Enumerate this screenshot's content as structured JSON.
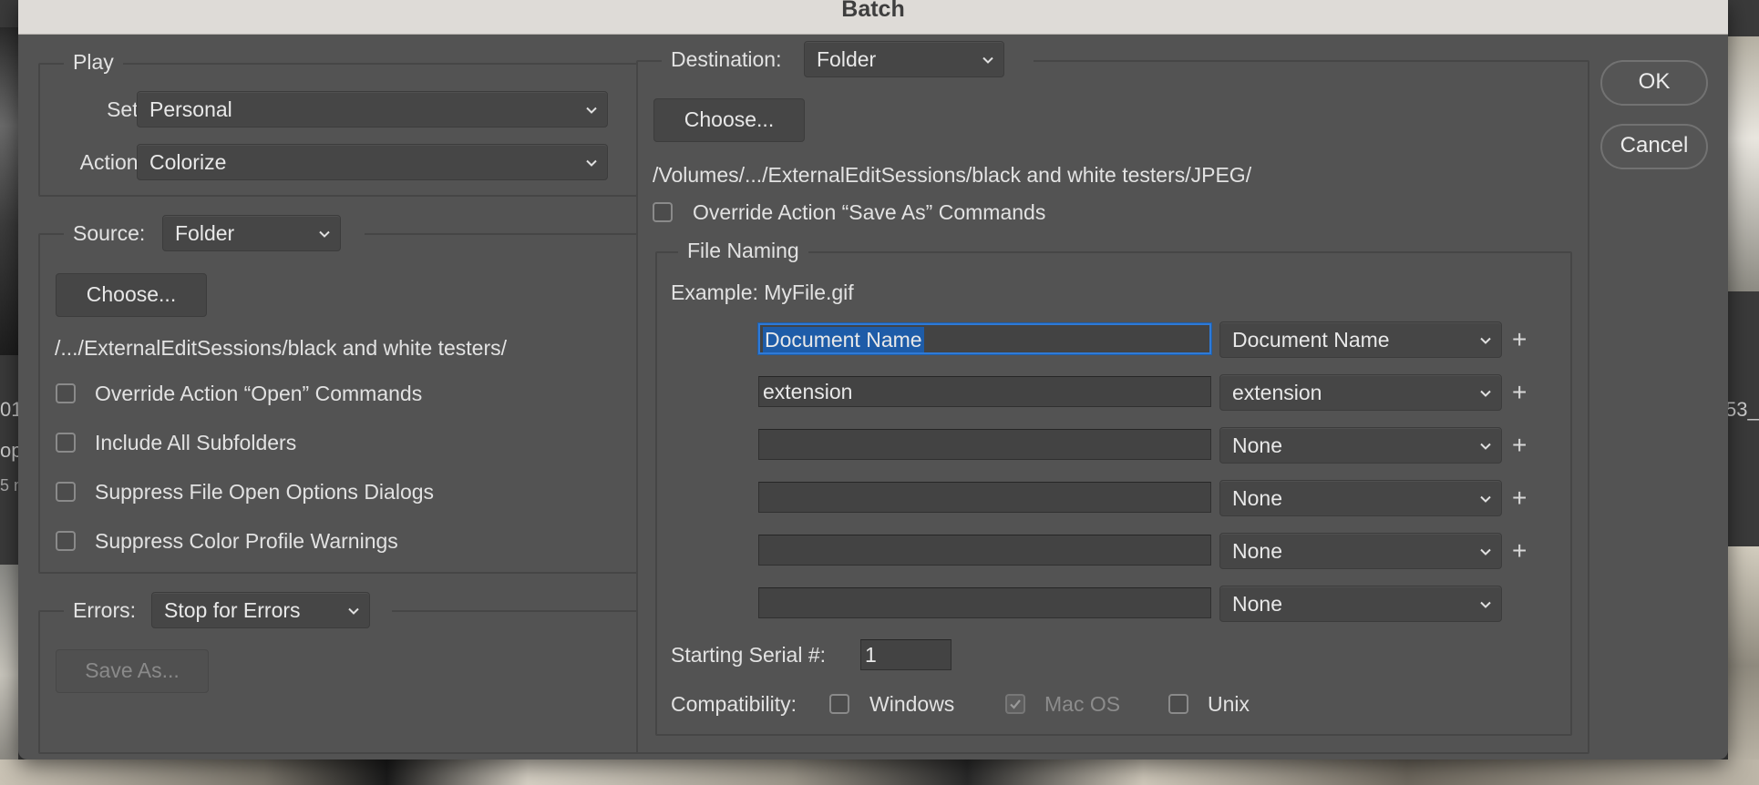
{
  "window": {
    "title": "Batch"
  },
  "play": {
    "legend": "Play",
    "set_label": "Set:",
    "set_value": "Personal",
    "action_label": "Action:",
    "action_value": "Colorize"
  },
  "source": {
    "label": "Source:",
    "value": "Folder",
    "choose_label": "Choose...",
    "path": "/.../ExternalEditSessions/black and white testers/",
    "checkboxes": [
      {
        "label": "Override Action “Open” Commands",
        "checked": false
      },
      {
        "label": "Include All Subfolders",
        "checked": false
      },
      {
        "label": "Suppress File Open Options Dialogs",
        "checked": false
      },
      {
        "label": "Suppress Color Profile Warnings",
        "checked": false
      }
    ]
  },
  "errors": {
    "label": "Errors:",
    "value": "Stop for Errors",
    "save_as_label": "Save As..."
  },
  "destination": {
    "label": "Destination:",
    "value": "Folder",
    "choose_label": "Choose...",
    "path": "/Volumes/.../ExternalEditSessions/black and white testers/JPEG/",
    "override_label": "Override Action “Save As” Commands",
    "override_checked": false
  },
  "file_naming": {
    "legend": "File Naming",
    "example": "Example: MyFile.gif",
    "rows": [
      {
        "text": "Document Name",
        "select": "Document Name",
        "plus": "+"
      },
      {
        "text": "extension",
        "select": "extension",
        "plus": "+"
      },
      {
        "text": "",
        "select": "None",
        "plus": "+"
      },
      {
        "text": "",
        "select": "None",
        "plus": "+"
      },
      {
        "text": "",
        "select": "None",
        "plus": "+"
      },
      {
        "text": "",
        "select": "None",
        "plus": ""
      }
    ],
    "serial_label": "Starting Serial #:",
    "serial_value": "1",
    "compat_label": "Compatibility:",
    "compat": [
      {
        "label": "Windows",
        "checked": false,
        "enabled": true
      },
      {
        "label": "Mac OS",
        "checked": true,
        "enabled": false
      },
      {
        "label": "Unix",
        "checked": false,
        "enabled": true
      }
    ]
  },
  "buttons": {
    "ok": "OK",
    "cancel": "Cancel"
  },
  "background": {
    "left_fragments": [
      "01",
      "op",
      "5 n"
    ],
    "right_fragment": "53_"
  },
  "colors": {
    "dialog_bg": "#535353",
    "focus_ring": "#2f7ad6",
    "title_bar": "#dedbd7"
  }
}
